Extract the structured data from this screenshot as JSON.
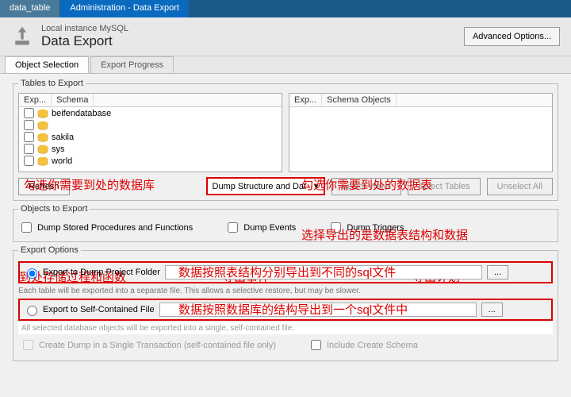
{
  "topTabs": {
    "data_table": "data_table",
    "admin": "Administration - Data Export"
  },
  "header": {
    "sub": "Local instance MySQL",
    "title": "Data Export",
    "adv": "Advanced Options..."
  },
  "subTabs": {
    "obj": "Object Selection",
    "prog": "Export Progress"
  },
  "tablesLegend": "Tables to Export",
  "leftPane": {
    "col1": "Exp...",
    "col2": "Schema",
    "rows": [
      "beifendatabase",
      "",
      "sakila",
      "sys",
      "world"
    ]
  },
  "rightPane": {
    "col1": "Exp...",
    "col2": "Schema Objects"
  },
  "refresh": "Refresh",
  "dumpSel": "Dump Structure and Dat",
  "btns": {
    "sv": "Select Views",
    "st": "Select Tables",
    "ua": "Unselect All"
  },
  "objLegend": "Objects to Export",
  "chk": {
    "sp": "Dump Stored Procedures and Functions",
    "ev": "Dump Events",
    "tr": "Dump Triggers"
  },
  "optLegend": "Export Options",
  "r1": "Export to Dump Project Folder",
  "r1path": "",
  "r1hint": "Each table will be exported into a separate file. This allows a selective restore, but may be slower.",
  "r2": "Export to Self-Contained File",
  "r2path": "",
  "r2hint": "All selected database objects will be exported into a single, self-contained file.",
  "final": {
    "t": "Create Dump in a Single Transaction (self-contained file only)",
    "s": "Include Create Schema"
  },
  "annot": {
    "a1": "勾选你需要到处的数据库",
    "a2": "勾选你需要到处的数据表",
    "a3": "选择导出的是数据表结构和数据",
    "a4": "到处存储过程和函数",
    "a5": "导出事件",
    "a6": "导出计划",
    "a7": "数据按照表结构分别导出到不同的sql文件",
    "a8": "数据按照数据库的结构导出到一个sql文件中"
  }
}
